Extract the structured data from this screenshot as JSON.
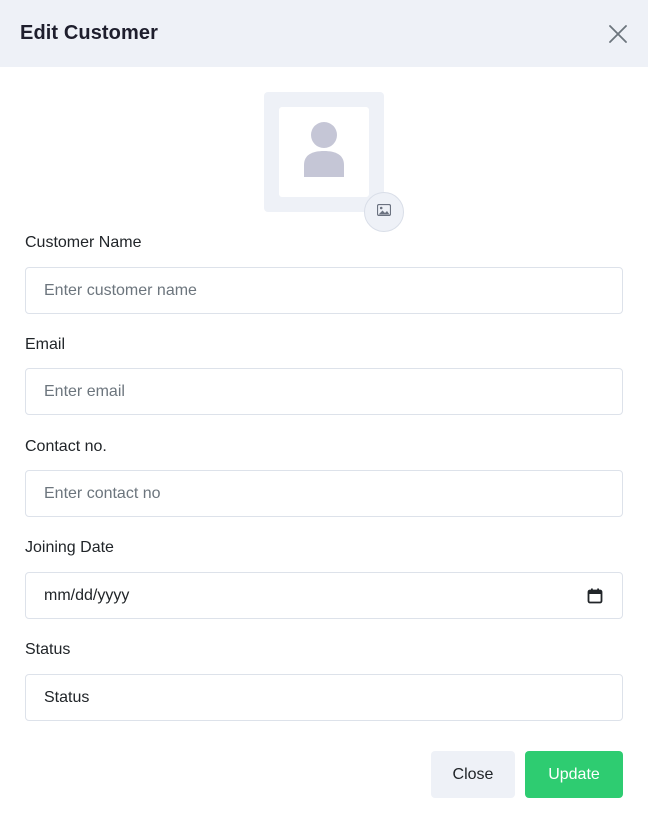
{
  "modal": {
    "title": "Edit Customer",
    "close_icon": "close-icon"
  },
  "avatar": {
    "placeholder_icon": "user-placeholder-icon",
    "upload_icon": "image-icon"
  },
  "form": {
    "customer_name": {
      "label": "Customer Name",
      "placeholder": "Enter customer name"
    },
    "email": {
      "label": "Email",
      "placeholder": "Enter email"
    },
    "contact": {
      "label": "Contact no.",
      "placeholder": "Enter contact no"
    },
    "joining_date": {
      "label": "Joining Date",
      "value": "mm/dd/yyyy",
      "icon": "calendar-icon"
    },
    "status": {
      "label": "Status",
      "value": "Status"
    }
  },
  "footer": {
    "close_label": "Close",
    "update_label": "Update"
  },
  "colors": {
    "header_bg": "#eef1f7",
    "accent": "#2ecc71",
    "border": "#dde2ea",
    "placeholder": "#6c757d"
  }
}
